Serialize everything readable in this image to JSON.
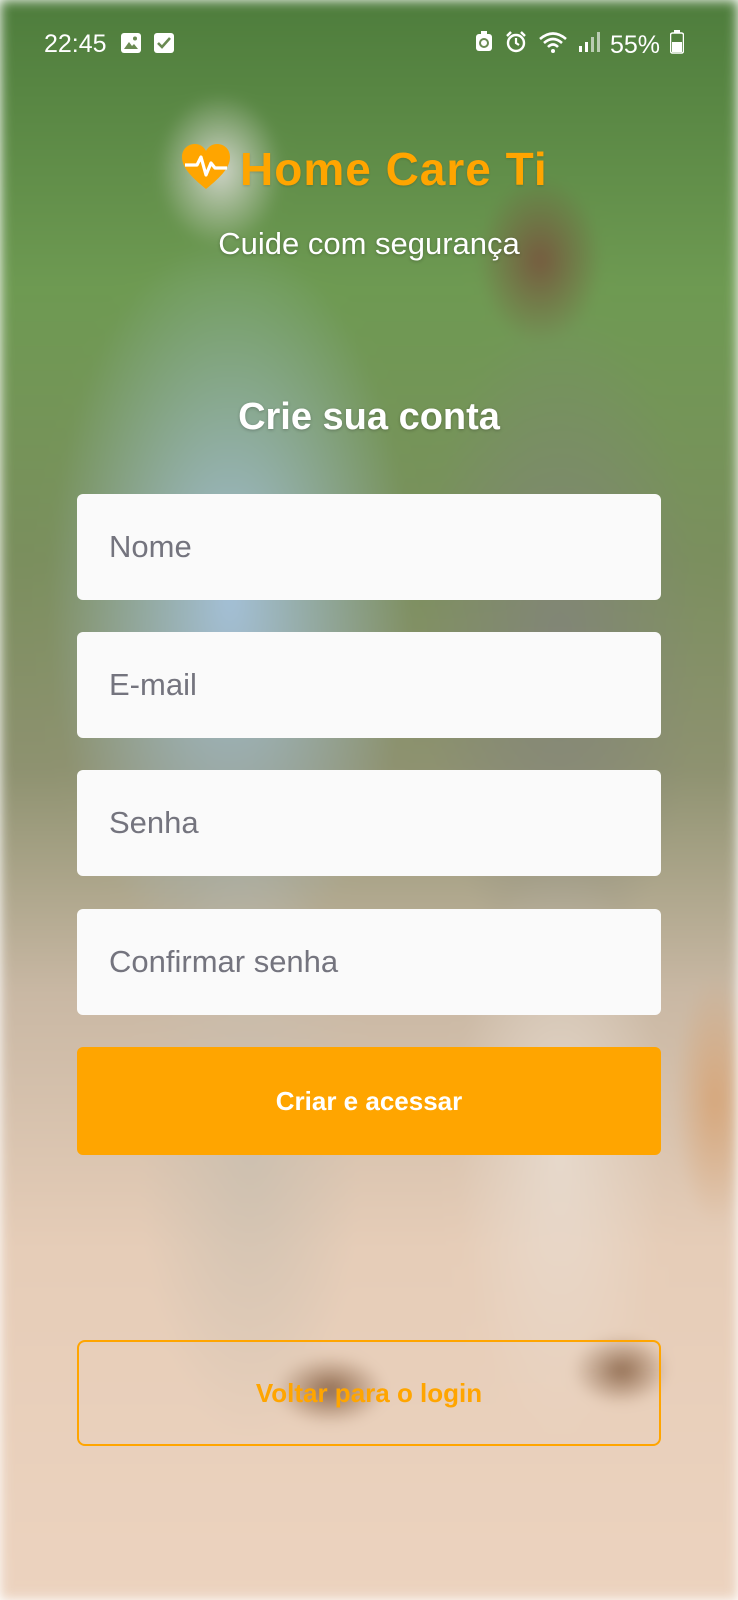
{
  "status_bar": {
    "time": "22:45",
    "battery": "55%",
    "icons_left": [
      "gallery-icon",
      "checkbox-icon"
    ],
    "icons_right": [
      "recycle-icon",
      "alarm-icon",
      "wifi-icon",
      "signal-icon",
      "battery-icon"
    ]
  },
  "app": {
    "name": "Home Care Ti",
    "tagline": "Cuide com segurança",
    "brand_color": "#FFA500"
  },
  "form": {
    "title": "Crie sua conta",
    "name_placeholder": "Nome",
    "email_placeholder": "E-mail",
    "password_placeholder": "Senha",
    "confirm_placeholder": "Confirmar senha",
    "submit_label": "Criar e acessar",
    "back_label": "Voltar para o login"
  }
}
